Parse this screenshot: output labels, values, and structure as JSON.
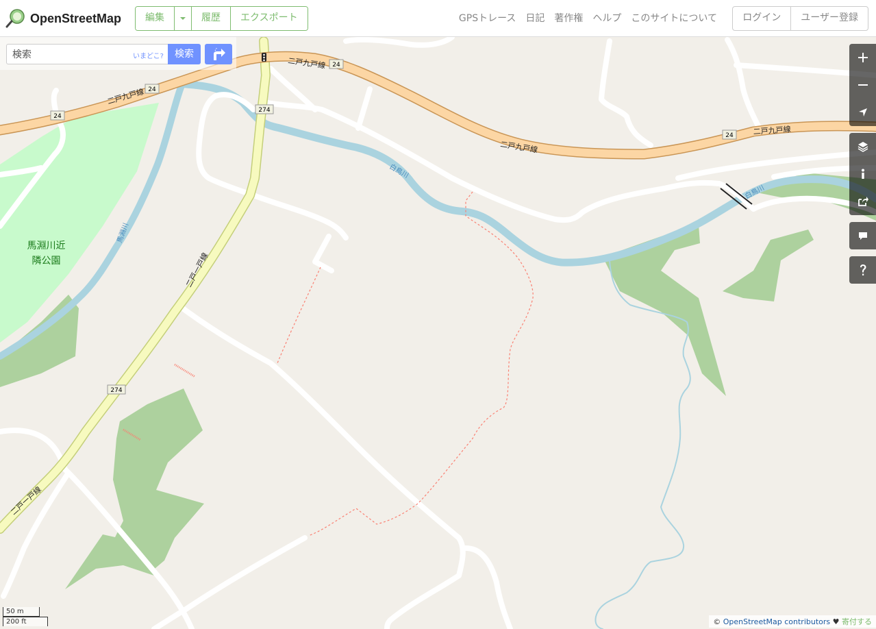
{
  "header": {
    "logo_text": "OpenStreetMap",
    "edit_label": "編集",
    "history_label": "履歴",
    "export_label": "エクスポート",
    "nav": [
      "GPSトレース",
      "日記",
      "著作権",
      "ヘルプ",
      "このサイトについて"
    ],
    "login_label": "ログイン",
    "signup_label": "ユーザー登録"
  },
  "search": {
    "placeholder": "検索",
    "where_link": "いまどこ?",
    "button_label": "検索"
  },
  "map": {
    "road_labels": {
      "route_24": "二戸九戸線",
      "route_274": "二戸一戸線",
      "river": "白鳥川",
      "river2": "馬淵川",
      "ref_24": "24",
      "ref_274": "274"
    },
    "park_label_line1": "馬淵川近",
    "park_label_line2": "隣公園",
    "colors": {
      "land": "#f2efe9",
      "primary_road": "#fcd6a4",
      "secondary_road": "#f7fabf",
      "water": "#aad3df",
      "woods": "#add19e",
      "park": "#c8facc",
      "accent": "#7092ff",
      "brand": "#7ebc6f"
    }
  },
  "scale": {
    "metric": "50 m",
    "imperial": "200 ft"
  },
  "attribution": {
    "prefix": "©",
    "link": "OpenStreetMap contributors",
    "heart": "♥",
    "donate": "寄付する"
  },
  "controls": [
    "zoom-in",
    "zoom-out",
    "locate",
    "layers",
    "info",
    "share",
    "note",
    "query"
  ]
}
